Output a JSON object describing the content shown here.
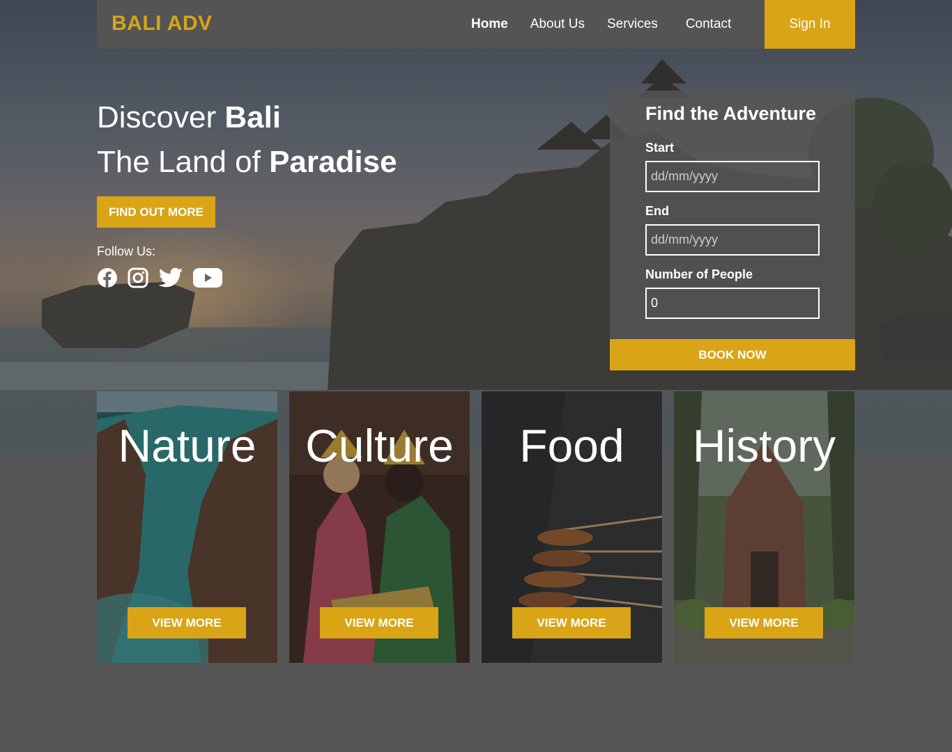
{
  "nav": {
    "logo": "BALI ADV",
    "links": [
      {
        "label": "Home",
        "active": true
      },
      {
        "label": "About Us",
        "active": false
      },
      {
        "label": "Services",
        "active": false
      },
      {
        "label": "Contact",
        "active": false
      }
    ],
    "signin": "Sign In"
  },
  "hero": {
    "line1_normal": "Discover ",
    "line1_bold": "Bali",
    "line2_normal": "The Land of ",
    "line2_bold": "Paradise",
    "cta": "FIND OUT MORE",
    "follow_label": "Follow Us:",
    "socials": [
      "facebook-icon",
      "instagram-icon",
      "twitter-icon",
      "youtube-icon"
    ]
  },
  "booking": {
    "title": "Find the Adventure",
    "start_label": "Start",
    "start_placeholder": "dd/mm/yyyy",
    "end_label": "End",
    "end_placeholder": "dd/mm/yyyy",
    "people_label": "Number of People",
    "people_value": "0",
    "submit": "BOOK NOW"
  },
  "cards": [
    {
      "title": "Nature",
      "button": "VIEW MORE"
    },
    {
      "title": "Culture",
      "button": "VIEW MORE"
    },
    {
      "title": "Food",
      "button": "VIEW MORE"
    },
    {
      "title": "History",
      "button": "VIEW MORE"
    }
  ],
  "colors": {
    "accent": "#d9a416",
    "nav_bg": "#545454",
    "page_bg": "#565656"
  }
}
